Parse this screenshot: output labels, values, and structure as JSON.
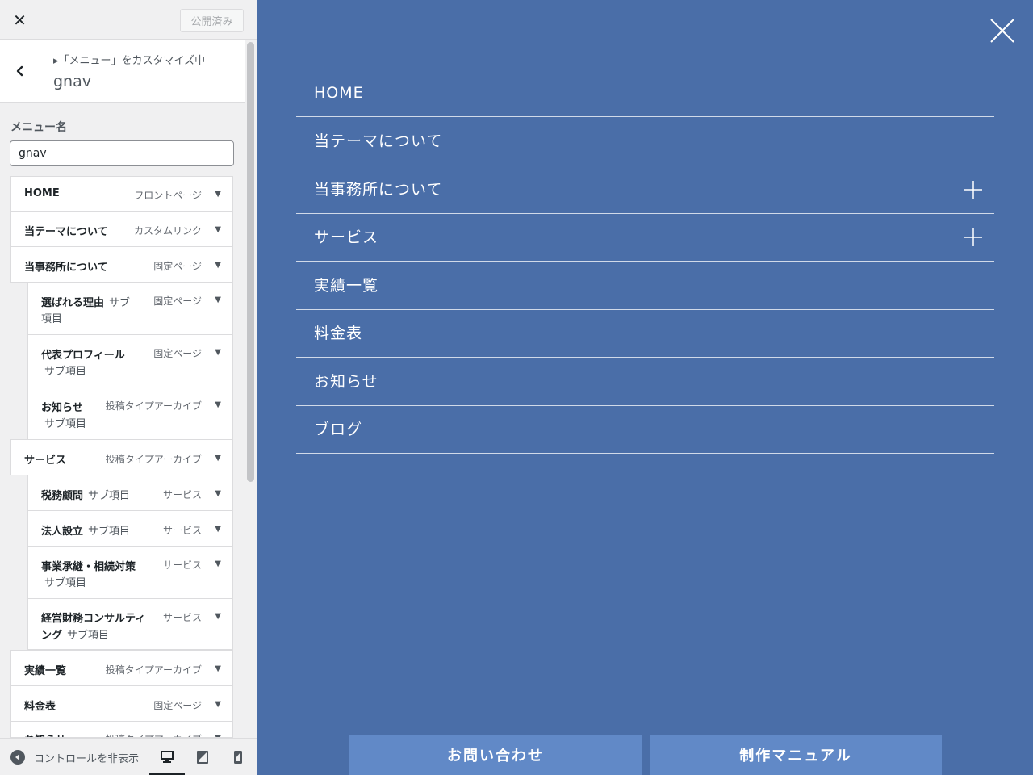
{
  "topbar": {
    "close": "✕",
    "publish_label": "公開済み"
  },
  "section": {
    "customizing": "▸「メニュー」をカスタマイズ中",
    "title": "gnav"
  },
  "menu_name": {
    "label": "メニュー名",
    "value": "gnav"
  },
  "menu_items": [
    {
      "title": "HOME",
      "type": "フロントページ"
    },
    {
      "title": "当テーマについて",
      "type": "カスタムリンク"
    },
    {
      "title": "当事務所について",
      "type": "固定ページ"
    },
    {
      "title": "選ばれる理由",
      "sub_inline": "サブ",
      "sub_line2": "項目",
      "type": "固定ページ"
    },
    {
      "title": "代表プロフィール",
      "sub_line2": "サブ項目",
      "type": "固定ページ"
    },
    {
      "title": "お知らせ",
      "sub_line2": "サブ項目",
      "type": "投稿タイプアーカイブ"
    },
    {
      "title": "サービス",
      "type": "投稿タイプアーカイブ"
    },
    {
      "title": "税務顧問",
      "sub_inline": "サブ項目",
      "type": "サービス"
    },
    {
      "title": "法人設立",
      "sub_inline": "サブ項目",
      "type": "サービス"
    },
    {
      "title": "事業承継・相続対策",
      "sub_line2": "サブ項目",
      "type": "サービス"
    },
    {
      "title": "経営財務コンサルティ",
      "title_line2": "ング",
      "sub_line2": "サブ項目",
      "type": "サービス"
    },
    {
      "title": "実績一覧",
      "type": "投稿タイプアーカイブ"
    },
    {
      "title": "料金表",
      "type": "固定ページ"
    },
    {
      "title": "お知らせ",
      "type": "投稿タイプアーカイブ"
    }
  ],
  "arrow": "▼",
  "bottombar": {
    "collapse_label": "コントロールを非表示"
  },
  "preview": {
    "nav": [
      {
        "label": "HOME"
      },
      {
        "label": "当テーマについて"
      },
      {
        "label": "当事務所について",
        "expandable": true
      },
      {
        "label": "サービス",
        "expandable": true
      },
      {
        "label": "実績一覧"
      },
      {
        "label": "料金表"
      },
      {
        "label": "お知らせ"
      },
      {
        "label": "ブログ"
      }
    ],
    "cta_contact": "お問い合わせ",
    "cta_manual": "制作マニュアル"
  },
  "colors": {
    "preview_bg": "#4a6ea8",
    "cta_bg": "#6189c7",
    "sidebar_bg": "#f0f0f1"
  }
}
